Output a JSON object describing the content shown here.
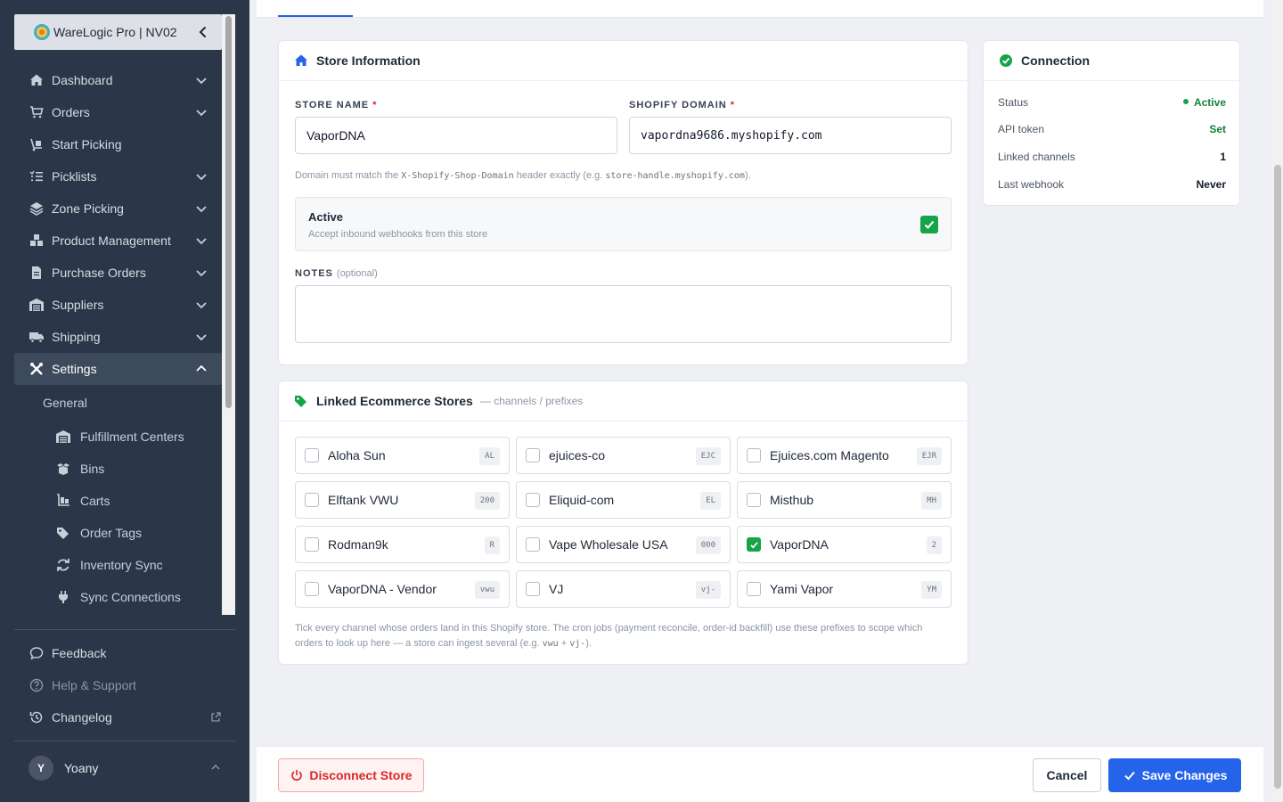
{
  "app": {
    "brand": "WareLogic Pro | NV02"
  },
  "sidebar": {
    "items": [
      {
        "label": "Dashboard",
        "icon": "home-icon"
      },
      {
        "label": "Orders",
        "icon": "cart-icon"
      },
      {
        "label": "Start Picking",
        "icon": "hand-cart-icon"
      },
      {
        "label": "Picklists",
        "icon": "list-icon"
      },
      {
        "label": "Zone Picking",
        "icon": "layers-icon"
      },
      {
        "label": "Product Management",
        "icon": "boxes-icon"
      },
      {
        "label": "Purchase Orders",
        "icon": "file-icon"
      },
      {
        "label": "Suppliers",
        "icon": "warehouse-icon"
      },
      {
        "label": "Shipping",
        "icon": "truck-icon"
      },
      {
        "label": "Settings",
        "icon": "tools-icon"
      }
    ],
    "settings_group": "General",
    "settings_sub": [
      {
        "label": "Fulfillment Centers",
        "icon": "warehouse-icon"
      },
      {
        "label": "Bins",
        "icon": "box-open-icon"
      },
      {
        "label": "Carts",
        "icon": "dolly-icon"
      },
      {
        "label": "Order Tags",
        "icon": "tags-icon"
      },
      {
        "label": "Inventory Sync",
        "icon": "sync-icon"
      },
      {
        "label": "Sync Connections",
        "icon": "plug-icon"
      }
    ],
    "bottom": [
      {
        "label": "Feedback",
        "icon": "comment-icon"
      },
      {
        "label": "Help & Support",
        "icon": "question-icon"
      },
      {
        "label": "Changelog",
        "icon": "history-icon"
      }
    ],
    "user": {
      "initial": "Y",
      "name": "Yoany"
    }
  },
  "store_info": {
    "title": "Store Information",
    "store_name_label": "STORE NAME",
    "store_name_value": "VaporDNA",
    "domain_label": "SHOPIFY DOMAIN",
    "domain_value": "vapordna9686.myshopify.com",
    "required_mark": "*",
    "hint_prefix": "Domain must match the ",
    "hint_header": "X-Shopify-Shop-Domain",
    "hint_middle": " header exactly (e.g. ",
    "hint_example": "store-handle.myshopify.com",
    "hint_suffix": ").",
    "active_title": "Active",
    "active_desc": "Accept inbound webhooks from this store",
    "active_checked": true,
    "notes_label": "NOTES",
    "notes_optional": "(optional)",
    "notes_value": ""
  },
  "linked": {
    "title": "Linked Ecommerce Stores",
    "subtitle": "— channels / prefixes",
    "stores": [
      {
        "name": "Aloha Sun",
        "code": "AL",
        "checked": false
      },
      {
        "name": "ejuices-co",
        "code": "EJC",
        "checked": false
      },
      {
        "name": "Ejuices.com Magento",
        "code": "EJR",
        "checked": false
      },
      {
        "name": "Elftank VWU",
        "code": "200",
        "checked": false
      },
      {
        "name": "Eliquid-com",
        "code": "EL",
        "checked": false
      },
      {
        "name": "Misthub",
        "code": "MH",
        "checked": false
      },
      {
        "name": "Rodman9k",
        "code": "R",
        "checked": false
      },
      {
        "name": "Vape Wholesale USA",
        "code": "000",
        "checked": false
      },
      {
        "name": "VaporDNA",
        "code": "2",
        "checked": true
      },
      {
        "name": "VaporDNA - Vendor",
        "code": "vwu",
        "checked": false
      },
      {
        "name": "VJ",
        "code": "vj-",
        "checked": false
      },
      {
        "name": "Yami Vapor",
        "code": "YM",
        "checked": false
      }
    ],
    "footnote_1": "Tick every channel whose orders land in this Shopify store. The cron jobs (payment reconcile, order-id backfill) use these prefixes to scope which",
    "footnote_2a": "orders to look up here — a store can ingest several (e.g. ",
    "footnote_code1": "vwu",
    "footnote_plus": " + ",
    "footnote_code2": "vj-",
    "footnote_2b": ")."
  },
  "connection": {
    "title": "Connection",
    "rows": [
      {
        "key": "Status",
        "value": "Active"
      },
      {
        "key": "API token",
        "value": "Set"
      },
      {
        "key": "Linked channels",
        "value": "1"
      },
      {
        "key": "Last webhook",
        "value": "Never"
      }
    ]
  },
  "footer": {
    "disconnect": "Disconnect Store",
    "cancel": "Cancel",
    "save": "Save Changes"
  },
  "colors": {
    "sidebar_bg": "#2b3748",
    "primary": "#2563eb",
    "success": "#16a34a",
    "danger": "#dc2626"
  }
}
